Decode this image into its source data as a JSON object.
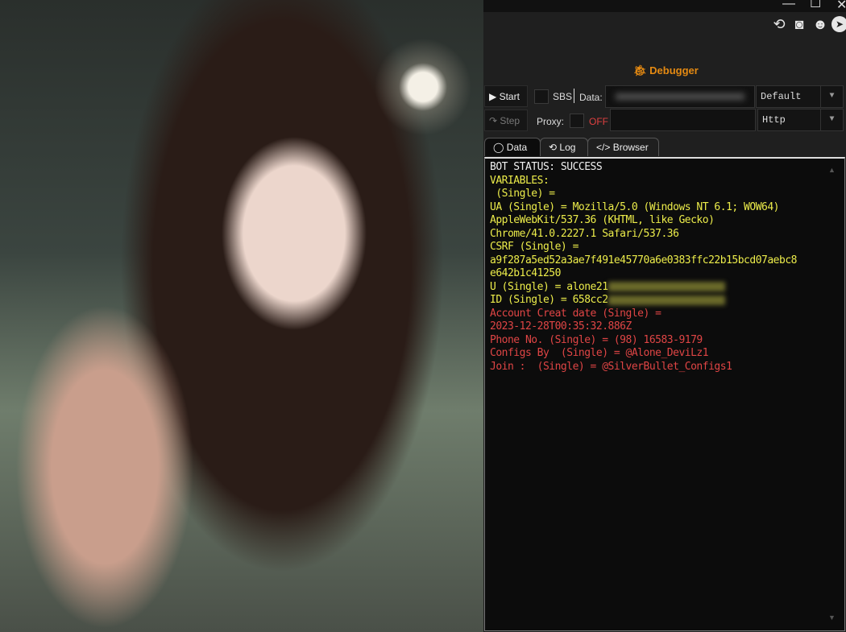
{
  "window": {
    "title": "Debugger"
  },
  "toolbar": {
    "start": "Start",
    "step": "Step",
    "sbs": "SBS",
    "data_label": "Data:",
    "data_mode": "Default",
    "proxy_label": "Proxy:",
    "proxy_state": "OFF",
    "proxy_type": "Http"
  },
  "tabs": [
    {
      "label": "Data"
    },
    {
      "label": "Log"
    },
    {
      "label": "Browser"
    }
  ],
  "output": {
    "lines": [
      {
        "text": "BOT STATUS: SUCCESS",
        "color": "white"
      },
      {
        "text": "VARIABLES:",
        "color": "yellow"
      },
      {
        "text": " (Single) =",
        "color": "yellow"
      },
      {
        "text": "UA (Single) = Mozilla/5.0 (Windows NT 6.1; WOW64)",
        "color": "yellow"
      },
      {
        "text": "AppleWebKit/537.36 (KHTML, like Gecko)",
        "color": "yellow"
      },
      {
        "text": "Chrome/41.0.2227.1 Safari/537.36",
        "color": "yellow"
      },
      {
        "text": "CSRF (Single) =",
        "color": "yellow"
      },
      {
        "text": "a9f287a5ed52a3ae7f491e45770a6e0383ffc22b15bcd07aebc8",
        "color": "yellow"
      },
      {
        "text": "e642b1c41250",
        "color": "yellow"
      },
      {
        "text": "U (Single) = alone21",
        "color": "yellow"
      },
      {
        "text": "ID (Single) = 658cc2",
        "color": "yellow"
      },
      {
        "text": "Account Creat date (Single) =",
        "color": "red"
      },
      {
        "text": "2023-12-28T00:35:32.886Z",
        "color": "red"
      },
      {
        "text": "Phone No. (Single) = (98) 16583-9179",
        "color": "red"
      },
      {
        "text": "Configs By  (Single) = @Alone_DeviLz1",
        "color": "red"
      },
      {
        "text": "Join :  (Single) = @SilverBullet_Configs1",
        "color": "red"
      }
    ]
  }
}
